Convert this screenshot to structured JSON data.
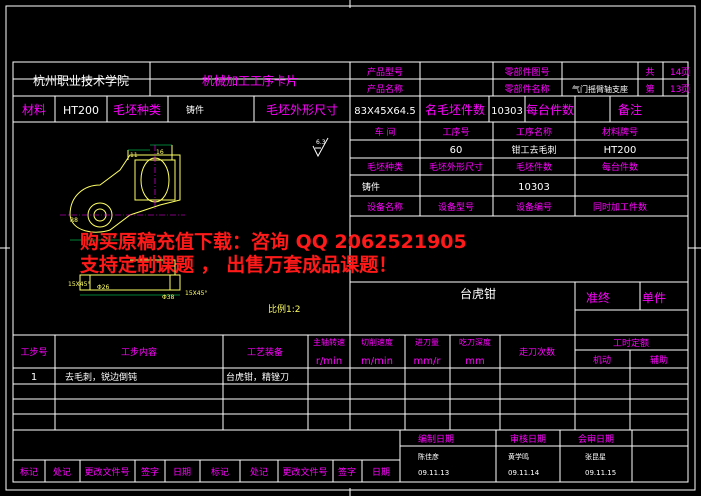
{
  "header": {
    "school": "杭州职业技术学院",
    "card_title": "机械加工工序卡片",
    "product_model_label": "产品型号",
    "product_name_label": "产品名称",
    "part_drawing_no_label": "零部件图号",
    "part_name_label": "零部件名称",
    "part_name_value": "气门摇臂轴支座",
    "total_label": "共",
    "total_value": "14",
    "page_unit": "页",
    "page_label": "第",
    "page_value": "13"
  },
  "material_row": {
    "material_label": "材料",
    "material_value": "HT200",
    "blank_type_label": "毛坯种类",
    "blank_type_value": "铸件",
    "blank_size_label": "毛坯外形尺寸",
    "blank_size_value": "83X45X64.5",
    "blank_count_label": "名毛坯件数",
    "blank_count_value": "10303",
    "units_per_label": "每台件数",
    "remark_label": "备注"
  },
  "drawing": {
    "scale_text": "比例1:2",
    "roughness": "6.3",
    "dims": [
      "11",
      "16",
      "R8",
      "15X45°",
      "Φ26",
      "Φ38",
      "15X45°"
    ]
  },
  "info_table": {
    "workshop_label": "车 间",
    "op_no_label": "工序号",
    "op_name_label": "工序名称",
    "mat_code_label": "材料牌号",
    "op_no_value": "60",
    "op_name_value": "钳工去毛刺",
    "mat_code_value": "HT200",
    "blank_type_label": "毛坯种类",
    "blank_size_label": "毛坯外形尺寸",
    "blank_count_label": "毛坯件数",
    "units_per_label": "每台件数",
    "blank_type_value": "铸件",
    "blank_count_value": "10303",
    "equip_name_label": "设备名称",
    "equip_model_label": "设备型号",
    "equip_no_label": "设备编号",
    "simul_label": "同时加工件数",
    "fixture_value": "台虎钳",
    "std_label": "准终",
    "unit_label": "单件"
  },
  "watermark": {
    "line1": "购买原稿充值下载：咨询 QQ 2062521905",
    "line2": "支持定制课题 ， 出售万套成品课题！"
  },
  "steps_table": {
    "col_step_no": "工步号",
    "col_step_content": "工步内容",
    "col_equipment": "工艺装备",
    "col_spindle": "主轴转速",
    "col_spindle_unit": "r/min",
    "col_cut_speed": "切削速度",
    "col_cut_speed_unit": "m/min",
    "col_feed": "进刀量",
    "col_feed_unit": "mm/r",
    "col_depth": "吃刀深度",
    "col_depth_unit": "mm",
    "col_passes": "走刀次数",
    "col_time": "工时定额",
    "col_machine": "机动",
    "col_aux": "辅助",
    "rows": [
      {
        "no": "1",
        "content": "去毛刺，锐边倒钝",
        "equipment": "台虎钳，精锉刀"
      }
    ]
  },
  "signoff": {
    "compile_label": "编制日期",
    "review_label": "审核日期",
    "countersign_label": "会审日期",
    "compile_name": "陈佳彦",
    "review_name": "黄学鸣",
    "countersign_name": "张昆星",
    "compile_date": "09.11.13",
    "review_date": "09.11.14",
    "countersign_date": "09.11.15",
    "mark_label": "标记",
    "place_label": "处记",
    "change_doc_label": "更改文件号",
    "sign_label": "签字",
    "date_label": "日期"
  }
}
